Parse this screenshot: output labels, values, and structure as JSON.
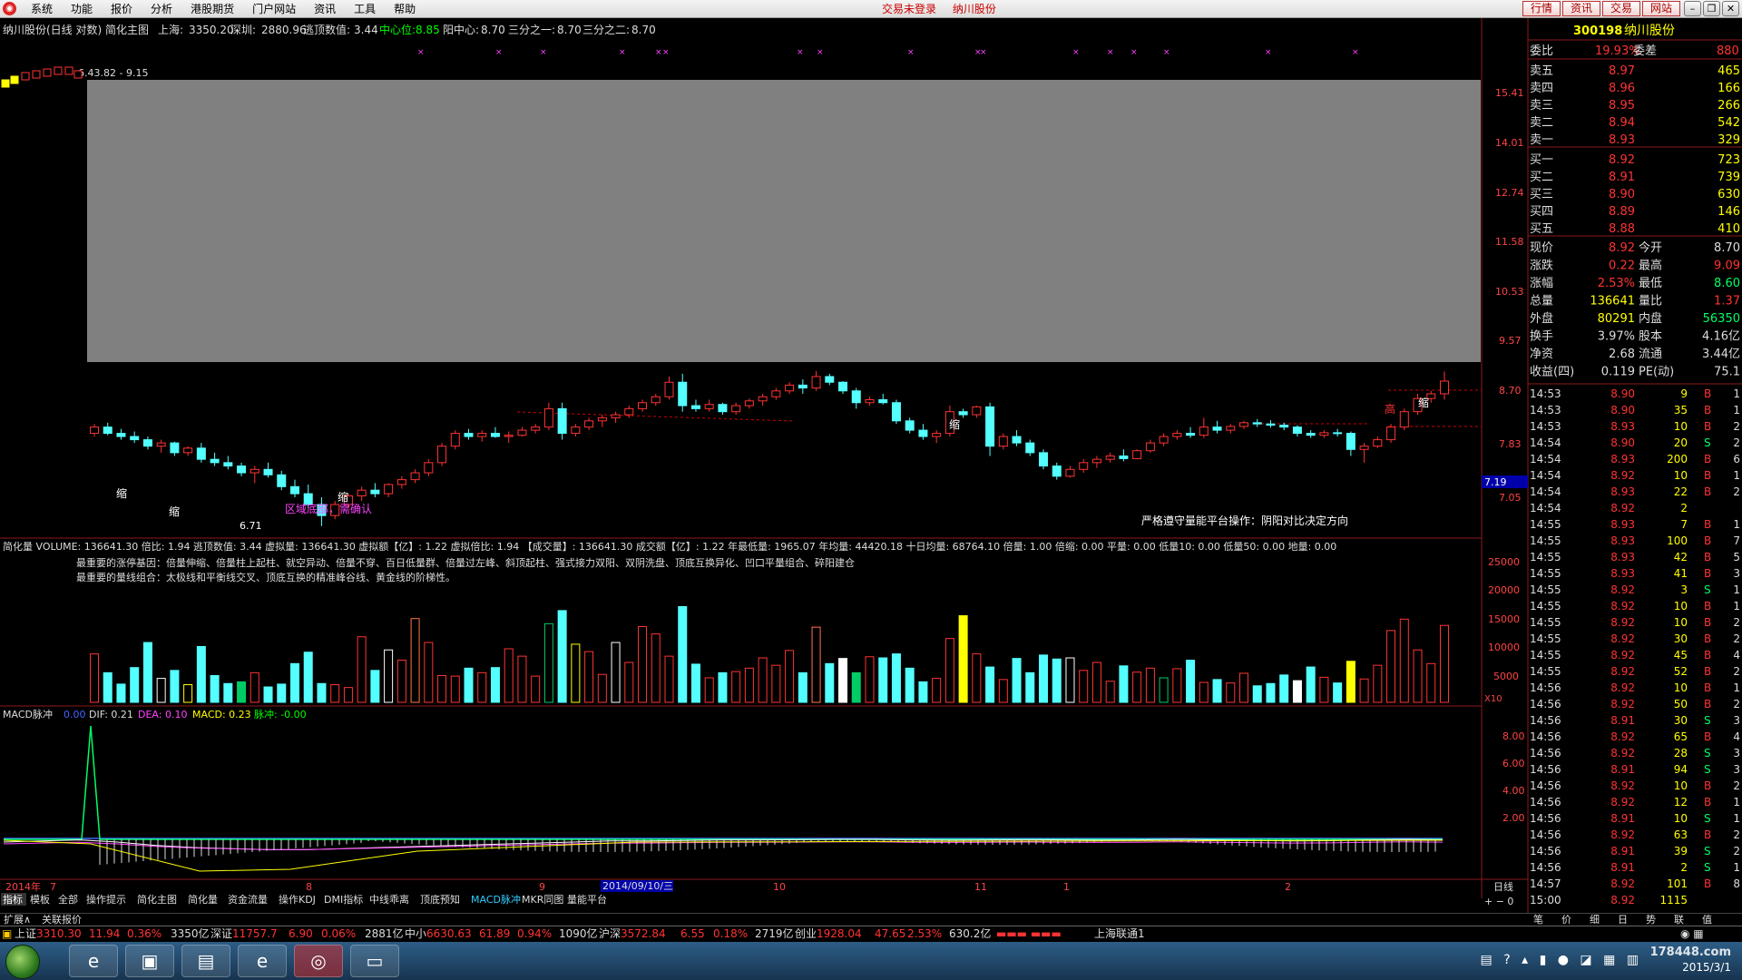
{
  "menu": {
    "items": [
      "系统",
      "功能",
      "报价",
      "分析",
      "港股期货",
      "门户网站",
      "资讯",
      "工具",
      "帮助"
    ],
    "status_login": "交易未登录",
    "status_stock": "纳川股份",
    "right_buttons": [
      "行情",
      "资讯",
      "交易",
      "网站"
    ]
  },
  "header": {
    "title": "纳川股份(日线 对数) 简化主图",
    "sh_label": "上海:",
    "sh_value": "3350.20",
    "sz_label": "深圳:",
    "sz_value": "2880.96",
    "escape_label": "逃顶数值:",
    "escape_value": "3.44",
    "center_label": "中心位:",
    "center_value": "8.85",
    "yang_label": "阳中心:",
    "yang_value": "8.70",
    "third1_label": "三分之一:",
    "third1_value": "8.70",
    "third2_label": "三分之二:",
    "third2_value": "8.70"
  },
  "price_panel": {
    "range_label": "6.43.82 - 9.15",
    "yaxis": [
      "15.41",
      "14.01",
      "12.74",
      "11.58",
      "10.53",
      "9.57",
      "8.70",
      "7.83",
      "7.05"
    ],
    "current_tag": "7.19",
    "annotations": {
      "shrink1": "缩",
      "shrink2": "缩",
      "shrink3": "缩",
      "shrink4": "缩",
      "shrink5": "缩",
      "shrink6": "缩",
      "high": "高",
      "low_mark": "6.71",
      "bottom_zone": "区域底部，需确认",
      "strategy": "严格遵守量能平台操作：阴阳对比决定方向"
    }
  },
  "volume_panel": {
    "line1": "简化量 VOLUME: 136641.30 倍比: 1.94 逃顶数值: 3.44 虚拟量: 136641.30 虚拟额【亿】: 1.22 虚拟倍比: 1.94 【成交量】: 136641.30 成交额【亿】: 1.22 年最低量: 1965.07 年均量: 44420.18 十日均量: 68764.10 倍量: 1.00 倍缩: 0.00 平量: 0.00 低量10: 0.00 低量50: 0.00 地量: 0.00",
    "note1": "最重要的涨停基因：倍量伸缩、倍量柱上起柱、就空异动、倍量不穿、百日低量群、倍量过左峰、斜顶起柱、强式接力双阳、双阴洗盘、顶底互换异化、凹口平量组合、碎阳建仓",
    "note2": "最重要的量线组合：太极线和平衡线交叉、顶底互换的精准峰谷线、黄金线的阶梯性。",
    "yaxis": [
      "25000",
      "20000",
      "15000",
      "10000",
      "5000"
    ],
    "unit": "X10"
  },
  "macd_panel": {
    "title": "MACD脉冲",
    "v0": "0.00",
    "dif": "DIF: 0.21",
    "dea": "DEA: 0.10",
    "macd": "MACD: 0.23",
    "pulse": "脉冲: -0.00",
    "yaxis": [
      "8.00",
      "6.00",
      "4.00",
      "2.00"
    ]
  },
  "xaxis": {
    "labels": [
      "2014年",
      "7",
      "8",
      "9",
      "10",
      "11",
      "1",
      "2"
    ],
    "cursor_date": "2014/09/10/三",
    "period": "日线"
  },
  "tabs": [
    "指标",
    "模板",
    "全部",
    "操作提示",
    "简化主图",
    "简化量",
    "资金流量",
    "操作KDJ",
    "DMI指标",
    "中线乖离",
    "顶底预知",
    "MACD脉冲",
    "MKR同图",
    "量能平台"
  ],
  "sub_tabs": [
    "扩展∧",
    "关联报价"
  ],
  "right_panel": {
    "code": "300198",
    "name": "纳川股份",
    "wb_label": "委比",
    "wb": "19.93%",
    "wc_label": "委差",
    "wc": "880",
    "asks": [
      {
        "label": "卖五",
        "price": "8.97",
        "vol": "465"
      },
      {
        "label": "卖四",
        "price": "8.96",
        "vol": "166"
      },
      {
        "label": "卖三",
        "price": "8.95",
        "vol": "266"
      },
      {
        "label": "卖二",
        "price": "8.94",
        "vol": "542"
      },
      {
        "label": "卖一",
        "price": "8.93",
        "vol": "329"
      }
    ],
    "bids": [
      {
        "label": "买一",
        "price": "8.92",
        "vol": "723"
      },
      {
        "label": "买二",
        "price": "8.91",
        "vol": "739"
      },
      {
        "label": "买三",
        "price": "8.90",
        "vol": "630"
      },
      {
        "label": "买四",
        "price": "8.89",
        "vol": "146"
      },
      {
        "label": "买五",
        "price": "8.88",
        "vol": "410"
      }
    ],
    "stats": [
      {
        "l1": "现价",
        "v1": "8.92",
        "l2": "今开",
        "v2": "8.70"
      },
      {
        "l1": "涨跌",
        "v1": "0.22",
        "l2": "最高",
        "v2": "9.09"
      },
      {
        "l1": "涨幅",
        "v1": "2.53%",
        "l2": "最低",
        "v2": "8.60"
      },
      {
        "l1": "总量",
        "v1": "136641",
        "l2": "量比",
        "v2": "1.37"
      },
      {
        "l1": "外盘",
        "v1": "80291",
        "l2": "内盘",
        "v2": "56350"
      },
      {
        "l1": "换手",
        "v1": "3.97%",
        "l2": "股本",
        "v2": "4.16亿"
      },
      {
        "l1": "净资",
        "v1": "2.68",
        "l2": "流通",
        "v2": "3.44亿"
      },
      {
        "l1": "收益(四)",
        "v1": "0.119",
        "l2": "PE(动)",
        "v2": "75.1"
      }
    ],
    "ticks": [
      [
        "14:53",
        "8.90",
        "9",
        "B",
        "1"
      ],
      [
        "14:53",
        "8.90",
        "35",
        "B",
        "1"
      ],
      [
        "14:53",
        "8.93",
        "10",
        "B",
        "2"
      ],
      [
        "14:54",
        "8.90",
        "20",
        "S",
        "2"
      ],
      [
        "14:54",
        "8.93",
        "200",
        "B",
        "6"
      ],
      [
        "14:54",
        "8.92",
        "10",
        "B",
        "1"
      ],
      [
        "14:54",
        "8.93",
        "22",
        "B",
        "2"
      ],
      [
        "14:54",
        "8.92",
        "2",
        "",
        ""
      ],
      [
        "14:55",
        "8.93",
        "7",
        "B",
        "1"
      ],
      [
        "14:55",
        "8.93",
        "100",
        "B",
        "7"
      ],
      [
        "14:55",
        "8.93",
        "42",
        "B",
        "5"
      ],
      [
        "14:55",
        "8.93",
        "41",
        "B",
        "3"
      ],
      [
        "14:55",
        "8.92",
        "3",
        "S",
        "1"
      ],
      [
        "14:55",
        "8.92",
        "10",
        "B",
        "1"
      ],
      [
        "14:55",
        "8.92",
        "10",
        "B",
        "2"
      ],
      [
        "14:55",
        "8.92",
        "30",
        "B",
        "2"
      ],
      [
        "14:55",
        "8.92",
        "45",
        "B",
        "4"
      ],
      [
        "14:55",
        "8.92",
        "52",
        "B",
        "2"
      ],
      [
        "14:56",
        "8.92",
        "10",
        "B",
        "1"
      ],
      [
        "14:56",
        "8.92",
        "50",
        "B",
        "2"
      ],
      [
        "14:56",
        "8.91",
        "30",
        "S",
        "3"
      ],
      [
        "14:56",
        "8.92",
        "65",
        "B",
        "4"
      ],
      [
        "14:56",
        "8.92",
        "28",
        "S",
        "3"
      ],
      [
        "14:56",
        "8.91",
        "94",
        "S",
        "3"
      ],
      [
        "14:56",
        "8.92",
        "10",
        "B",
        "2"
      ],
      [
        "14:56",
        "8.92",
        "12",
        "B",
        "1"
      ],
      [
        "14:56",
        "8.91",
        "10",
        "S",
        "1"
      ],
      [
        "14:56",
        "8.92",
        "63",
        "B",
        "2"
      ],
      [
        "14:56",
        "8.91",
        "39",
        "S",
        "2"
      ],
      [
        "14:56",
        "8.91",
        "2",
        "S",
        "1"
      ],
      [
        "14:57",
        "8.92",
        "101",
        "B",
        "8"
      ],
      [
        "15:00",
        "8.92",
        "1115",
        "",
        ""
      ]
    ],
    "bottom_tabs": [
      "笔",
      "价",
      "细",
      "日",
      "势",
      "联",
      "值",
      "筹"
    ]
  },
  "index_bar": {
    "items": [
      {
        "name": "上证",
        "price": "3310.30",
        "chg": "11.94",
        "pct": "0.36%",
        "amt": "3350亿"
      },
      {
        "name": "深证",
        "price": "11757.7",
        "chg": "6.90",
        "pct": "0.06%",
        "amt": "2881亿"
      },
      {
        "name": "中小",
        "price": "6630.63",
        "chg": "61.89",
        "pct": "0.94%",
        "amt": "1090亿"
      },
      {
        "name": "沪深",
        "price": "3572.84",
        "chg": "6.55",
        "pct": "0.18%",
        "amt": "2719亿"
      },
      {
        "name": "创业",
        "price": "1928.04",
        "chg": "47.65",
        "pct": "2.53%",
        "amt": "630.2亿"
      }
    ],
    "broker": "上海联通1"
  },
  "taskbar": {
    "date": "2015/3/1",
    "watermark": "178448.com"
  },
  "chart_data": {
    "type": "candlestick",
    "title": "纳川股份(日线 对数) 简化主图",
    "ohlc": [
      [
        8.05,
        8.2,
        8.0,
        8.15
      ],
      [
        8.15,
        8.22,
        8.02,
        8.05
      ],
      [
        8.05,
        8.12,
        7.95,
        8.0
      ],
      [
        8.0,
        8.08,
        7.9,
        7.95
      ],
      [
        7.95,
        8.0,
        7.8,
        7.85
      ],
      [
        7.85,
        7.95,
        7.75,
        7.9
      ],
      [
        7.9,
        7.92,
        7.7,
        7.75
      ],
      [
        7.75,
        7.85,
        7.7,
        7.82
      ],
      [
        7.82,
        7.9,
        7.6,
        7.65
      ],
      [
        7.65,
        7.75,
        7.55,
        7.6
      ],
      [
        7.6,
        7.7,
        7.5,
        7.55
      ],
      [
        7.55,
        7.6,
        7.4,
        7.45
      ],
      [
        7.45,
        7.55,
        7.3,
        7.5
      ],
      [
        7.5,
        7.6,
        7.38,
        7.42
      ],
      [
        7.42,
        7.48,
        7.2,
        7.25
      ],
      [
        7.25,
        7.35,
        7.1,
        7.15
      ],
      [
        7.15,
        7.28,
        6.95,
        7.0
      ],
      [
        7.0,
        7.1,
        6.71,
        6.85
      ],
      [
        6.85,
        7.05,
        6.8,
        7.0
      ],
      [
        7.0,
        7.15,
        6.95,
        7.12
      ],
      [
        7.12,
        7.25,
        7.05,
        7.2
      ],
      [
        7.2,
        7.3,
        7.1,
        7.15
      ],
      [
        7.15,
        7.3,
        7.1,
        7.28
      ],
      [
        7.28,
        7.4,
        7.22,
        7.35
      ],
      [
        7.35,
        7.5,
        7.3,
        7.45
      ],
      [
        7.45,
        7.65,
        7.4,
        7.6
      ],
      [
        7.6,
        7.9,
        7.55,
        7.85
      ],
      [
        7.85,
        8.1,
        7.8,
        8.05
      ],
      [
        8.05,
        8.12,
        7.95,
        8.0
      ],
      [
        8.0,
        8.1,
        7.92,
        8.05
      ],
      [
        8.05,
        8.15,
        7.98,
        8.0
      ],
      [
        8.0,
        8.08,
        7.9,
        8.02
      ],
      [
        8.02,
        8.15,
        8.0,
        8.1
      ],
      [
        8.1,
        8.2,
        8.05,
        8.15
      ],
      [
        8.15,
        8.55,
        8.1,
        8.45
      ],
      [
        8.45,
        8.55,
        7.95,
        8.05
      ],
      [
        8.05,
        8.2,
        8.0,
        8.15
      ],
      [
        8.15,
        8.3,
        8.1,
        8.25
      ],
      [
        8.25,
        8.35,
        8.15,
        8.3
      ],
      [
        8.3,
        8.4,
        8.22,
        8.35
      ],
      [
        8.35,
        8.5,
        8.3,
        8.45
      ],
      [
        8.45,
        8.6,
        8.4,
        8.55
      ],
      [
        8.55,
        8.7,
        8.5,
        8.65
      ],
      [
        8.65,
        9.0,
        8.6,
        8.9
      ],
      [
        8.9,
        9.05,
        8.4,
        8.5
      ],
      [
        8.5,
        8.6,
        8.4,
        8.45
      ],
      [
        8.45,
        8.6,
        8.4,
        8.52
      ],
      [
        8.52,
        8.55,
        8.35,
        8.4
      ],
      [
        8.4,
        8.55,
        8.35,
        8.5
      ],
      [
        8.5,
        8.62,
        8.45,
        8.58
      ],
      [
        8.58,
        8.7,
        8.5,
        8.65
      ],
      [
        8.65,
        8.8,
        8.6,
        8.75
      ],
      [
        8.75,
        8.9,
        8.7,
        8.85
      ],
      [
        8.85,
        8.95,
        8.7,
        8.8
      ],
      [
        8.8,
        9.1,
        8.75,
        9.0
      ],
      [
        9.0,
        9.05,
        8.85,
        8.9
      ],
      [
        8.9,
        8.92,
        8.7,
        8.75
      ],
      [
        8.75,
        8.8,
        8.45,
        8.55
      ],
      [
        8.55,
        8.65,
        8.5,
        8.6
      ],
      [
        8.6,
        8.7,
        8.52,
        8.55
      ],
      [
        8.55,
        8.6,
        8.2,
        8.25
      ],
      [
        8.25,
        8.3,
        8.05,
        8.1
      ],
      [
        8.1,
        8.2,
        7.95,
        8.0
      ],
      [
        8.0,
        8.1,
        7.9,
        8.05
      ],
      [
        8.05,
        8.5,
        8.0,
        8.4
      ],
      [
        8.4,
        8.45,
        8.3,
        8.35
      ],
      [
        8.35,
        8.5,
        8.3,
        8.48
      ],
      [
        8.48,
        8.55,
        7.7,
        7.85
      ],
      [
        7.85,
        8.05,
        7.8,
        8.0
      ],
      [
        8.0,
        8.1,
        7.85,
        7.9
      ],
      [
        7.9,
        7.95,
        7.7,
        7.75
      ],
      [
        7.75,
        7.8,
        7.5,
        7.55
      ],
      [
        7.55,
        7.6,
        7.35,
        7.4
      ],
      [
        7.4,
        7.55,
        7.38,
        7.5
      ],
      [
        7.5,
        7.65,
        7.45,
        7.6
      ],
      [
        7.6,
        7.7,
        7.52,
        7.65
      ],
      [
        7.65,
        7.75,
        7.6,
        7.7
      ],
      [
        7.7,
        7.8,
        7.62,
        7.66
      ],
      [
        7.66,
        7.8,
        7.65,
        7.78
      ],
      [
        7.78,
        7.95,
        7.75,
        7.9
      ],
      [
        7.9,
        8.05,
        7.85,
        8.0
      ],
      [
        8.0,
        8.1,
        7.95,
        8.05
      ],
      [
        8.05,
        8.15,
        7.98,
        8.02
      ],
      [
        8.02,
        8.3,
        7.98,
        8.15
      ],
      [
        8.15,
        8.25,
        8.05,
        8.1
      ],
      [
        8.1,
        8.2,
        8.05,
        8.16
      ],
      [
        8.16,
        8.25,
        8.12,
        8.22
      ],
      [
        8.22,
        8.28,
        8.15,
        8.2
      ],
      [
        8.2,
        8.26,
        8.14,
        8.18
      ],
      [
        8.18,
        8.22,
        8.1,
        8.15
      ],
      [
        8.15,
        8.18,
        8.0,
        8.05
      ],
      [
        8.05,
        8.1,
        7.98,
        8.02
      ],
      [
        8.02,
        8.1,
        7.98,
        8.06
      ],
      [
        8.06,
        8.12,
        8.0,
        8.05
      ],
      [
        8.05,
        8.08,
        7.7,
        7.8
      ],
      [
        7.8,
        7.9,
        7.6,
        7.85
      ],
      [
        7.85,
        8.0,
        7.82,
        7.95
      ],
      [
        7.95,
        8.2,
        7.9,
        8.15
      ],
      [
        8.15,
        8.45,
        8.1,
        8.4
      ],
      [
        8.4,
        8.7,
        8.35,
        8.62
      ],
      [
        8.62,
        8.75,
        8.55,
        8.7
      ],
      [
        8.7,
        9.09,
        8.6,
        8.92
      ]
    ],
    "volume": [
      8500,
      5200,
      3200,
      6100,
      10500,
      4200,
      5600,
      3100,
      9800,
      4700,
      3300,
      3600,
      5200,
      2700,
      3200,
      6800,
      8800,
      3300,
      3100,
      2600,
      11500,
      5600,
      9200,
      7400,
      14700,
      10500,
      4700,
      4600,
      6000,
      5200,
      6100,
      9400,
      8100,
      4600,
      13800,
      16100,
      10200,
      8900,
      4900,
      10500,
      7000,
      13300,
      12000,
      8100,
      16800,
      6700,
      4300,
      5200,
      5400,
      6000,
      7800,
      6500,
      9100,
      5200,
      13200,
      6800,
      7700,
      5200,
      8000,
      7800,
      8500,
      6000,
      3600,
      4200,
      11200,
      15200,
      8500,
      6200,
      4000,
      7700,
      5200,
      8300,
      7600,
      7800,
      5600,
      7000,
      3700,
      6400,
      5300,
      6000,
      4300,
      5900,
      7400,
      3500,
      4000,
      3400,
      5100,
      2900,
      3300,
      4800,
      3800,
      6200,
      4400,
      3400,
      7200,
      4100,
      6500,
      12600,
      14600,
      9200,
      6800,
      13500
    ],
    "macd_dif": [
      0.0,
      0.1,
      0.2,
      0.0,
      -0.3,
      -0.5,
      -0.6,
      -0.7,
      -0.7,
      -0.6,
      -0.5,
      -0.4,
      -0.3,
      -0.2,
      -0.1,
      0.0,
      0.1,
      0.1,
      0.15,
      0.2,
      0.2,
      0.22,
      0.25,
      0.25,
      0.2,
      0.18,
      0.2,
      0.22,
      0.2,
      0.18,
      0.2,
      0.25,
      0.2,
      0.15,
      0.1,
      0.12,
      0.2,
      0.25,
      0.21
    ],
    "yaxis_price": [
      "15.41",
      "14.01",
      "12.74",
      "11.58",
      "10.53",
      "9.57",
      "8.70",
      "7.83",
      "7.05"
    ]
  }
}
